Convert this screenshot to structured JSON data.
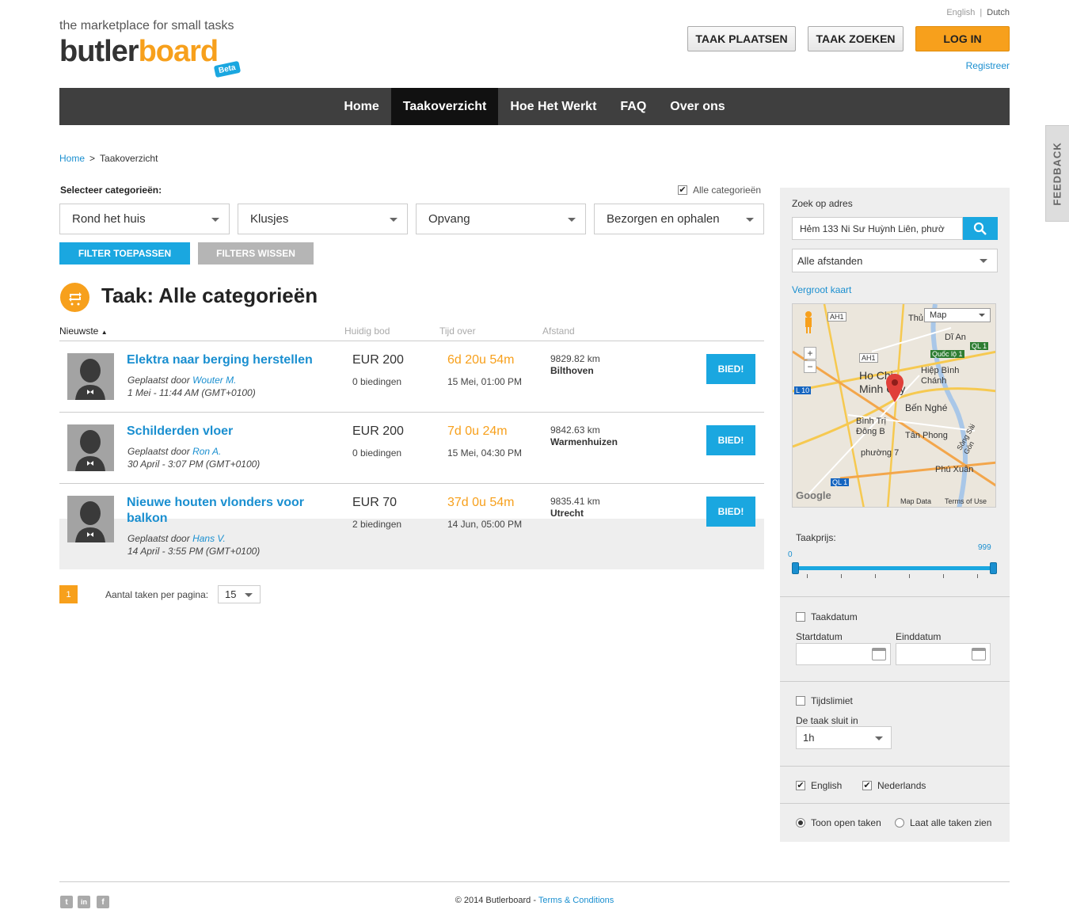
{
  "header": {
    "tagline": "the marketplace for small tasks",
    "logo_part1": "butler",
    "logo_part2": "board",
    "beta": "Beta",
    "lang_en": "English",
    "lang_sep": "|",
    "lang_nl": "Dutch",
    "post_task": "TAAK PLAATSEN",
    "find_task": "TAAK ZOEKEN",
    "login": "LOG IN",
    "register": "Registreer"
  },
  "nav": {
    "items": [
      "Home",
      "Taakoverzicht",
      "Hoe Het Werkt",
      "FAQ",
      "Over ons"
    ],
    "active": "Taakoverzicht"
  },
  "breadcrumb": {
    "home": "Home",
    "sep": ">",
    "current": "Taakoverzicht"
  },
  "filters": {
    "select_label": "Selecteer categorieën:",
    "all_categories": "Alle categorieën",
    "all_checked": true,
    "dropdowns": [
      "Rond het huis",
      "Klusjes",
      "Opvang",
      "Bezorgen en ophalen"
    ],
    "apply": "FILTER TOEPASSEN",
    "clear": "FILTERS WISSEN"
  },
  "title": "Taak: Alle categorieën",
  "table": {
    "headers": {
      "sort": "Nieuwste",
      "bid": "Huidig bod",
      "time": "Tijd over",
      "distance": "Afstand"
    },
    "rows": [
      {
        "title": "Elektra naar berging herstellen",
        "posted_prefix": "Geplaatst door",
        "posted_by": "Wouter M.",
        "date": "1 Mei - 11:44 AM (GMT+0100)",
        "bid": "EUR 200",
        "bids": "0 biedingen",
        "time_left": "6d 20u 54m",
        "time_date": "15 Mei, 01:00 PM",
        "distance": "9829.82 km",
        "city": "Bilthoven",
        "button": "BIED!"
      },
      {
        "title": "Schilderden vloer",
        "posted_prefix": "Geplaatst door",
        "posted_by": "Ron A.",
        "date": "30 April - 3:07 PM (GMT+0100)",
        "bid": "EUR 200",
        "bids": "0 biedingen",
        "time_left": "7d 0u 24m",
        "time_date": "15 Mei, 04:30 PM",
        "distance": "9842.63 km",
        "city": "Warmenhuizen",
        "button": "BIED!"
      },
      {
        "title": "Nieuwe houten vlonders voor balkon",
        "posted_prefix": "Geplaatst door",
        "posted_by": "Hans V.",
        "date": "14 April - 3:55 PM (GMT+0100)",
        "bid": "EUR 70",
        "bids": "2 biedingen",
        "time_left": "37d 0u 54m",
        "time_date": "14 Jun, 05:00 PM",
        "distance": "9835.41 km",
        "city": "Utrecht",
        "button": "BIED!"
      }
    ]
  },
  "pagination": {
    "page": "1",
    "per_page_label": "Aantal taken per pagina:",
    "per_page": "15"
  },
  "sidebar": {
    "address_label": "Zoek op adres",
    "address_value": "Hẻm 133 Ni Sư Huỳnh Liên, phườ",
    "distance": "Alle afstanden",
    "enlarge_map": "Vergroot kaart",
    "map": {
      "type": "Map",
      "labels": [
        "Ho Chi Minh City",
        "Bến Nghé",
        "Hiệp Bình Chánh",
        "Dĩ An",
        "Bình Trị Đông B",
        "Tân Phong",
        "phường 7",
        "Phú Xuân",
        "Thủ",
        "Sông Sài Gòn"
      ],
      "roads": [
        "AH1",
        "AH1",
        "QL 1",
        "L 10",
        "Quốc lộ 1",
        "QL 1"
      ],
      "map_data": "Map Data",
      "terms": "Terms of Use",
      "google": "Google"
    },
    "price_label": "Taakprijs:",
    "price_min": "0",
    "price_max": "999",
    "date_label": "Taakdatum",
    "start_label": "Startdatum",
    "end_label": "Einddatum",
    "timelimit_label": "Tijdslimiet",
    "closes_label": "De taak sluit in",
    "closes_value": "1h",
    "lang_english": "English",
    "lang_dutch": "Nederlands",
    "show_open": "Toon open taken",
    "show_all": "Laat alle taken zien"
  },
  "feedback": "FEEDBACK",
  "footer": {
    "copyright": "© 2014 Butlerboard - ",
    "terms": "Terms & Conditions",
    "social": [
      "twitter-icon",
      "linkedin-icon",
      "facebook-icon"
    ]
  },
  "colors": {
    "accent_orange": "#f7a01c",
    "accent_blue": "#1aa7e0",
    "nav_bg": "#3f3f3f"
  }
}
